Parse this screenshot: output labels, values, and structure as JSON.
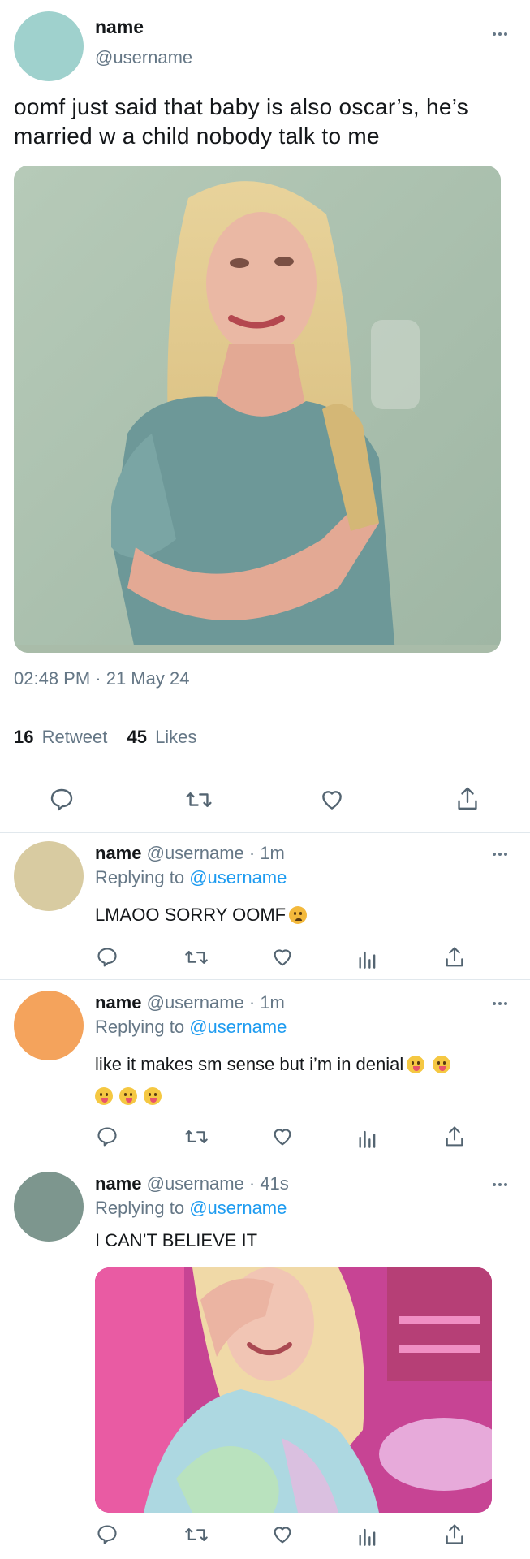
{
  "main_tweet": {
    "name": "name",
    "username": "@username",
    "avatar_color": "#9fd1cd",
    "text_line1": "oomf just said that baby is also oscar’s, he’s",
    "text_line2": "married w a child nobody talk to me",
    "timestamp": "02:48 PM · 21 May 24",
    "retweet_count": "16",
    "retweet_label": "Retweet",
    "likes_count": "45",
    "likes_label": "Likes"
  },
  "replies": [
    {
      "name": "name",
      "username": "@username · 1m",
      "replying_prefix": "Replying to",
      "replying_to": "@username",
      "avatar_color": "#d8cba1",
      "text": "LMAOO SORRY OOMF"
    },
    {
      "name": "name",
      "username": "@username · 1m",
      "replying_prefix": "Replying to",
      "replying_to": "@username",
      "avatar_color": "#f4a35c",
      "text": "like it makes sm sense but i’m in denial"
    },
    {
      "name": "name",
      "username": "@username · 41s",
      "replying_prefix": "Replying to",
      "replying_to": "@username",
      "avatar_color": "#7d968e",
      "text": "I CAN’T BELIEVE IT"
    }
  ],
  "icons": [
    "more-icon",
    "reply-icon",
    "retweet-icon",
    "like-icon",
    "share-icon",
    "analytics-icon"
  ],
  "colors": {
    "text": "#14171a",
    "secondary": "#657786",
    "link": "#1d9bf0",
    "divider": "#e1e8ed"
  }
}
